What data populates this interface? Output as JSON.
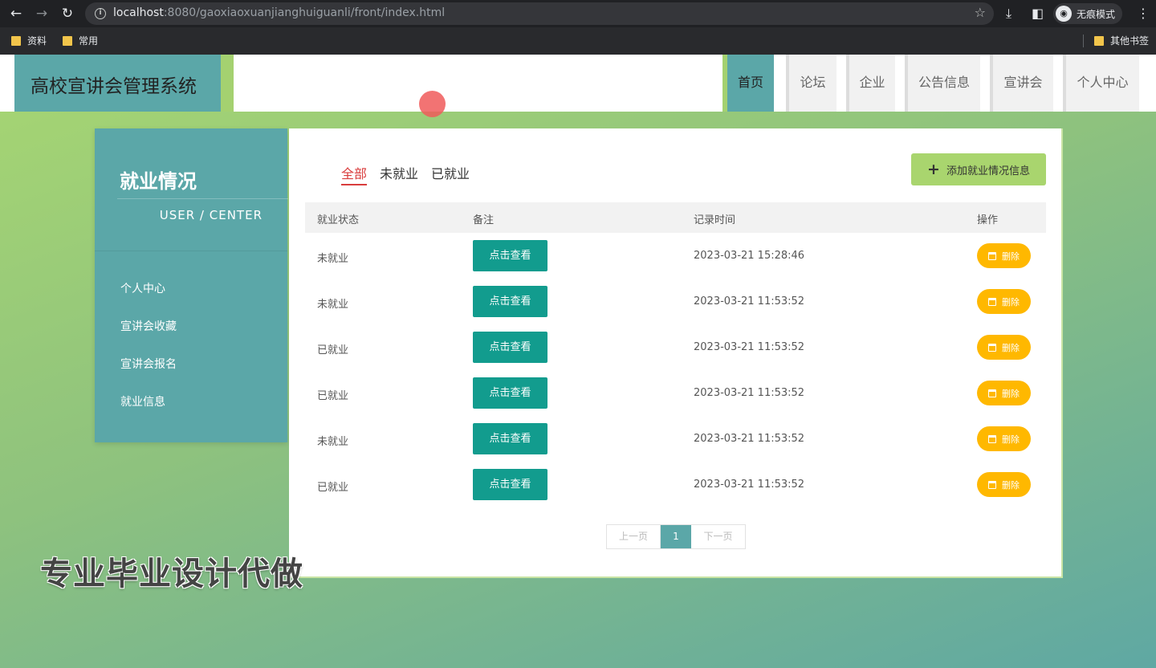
{
  "browser": {
    "back_icon": "arrow-left-icon",
    "url_host": "localhost",
    "url_path": ":8080/gaoxiaoxuanjianghuiguanli/front/index.html",
    "incognito_label": "无痕模式",
    "bookmarks": [
      "资料",
      "常用"
    ],
    "other_bookmarks": "其他书签"
  },
  "header": {
    "site_title": "高校宣讲会管理系统",
    "menu": [
      "首页",
      "论坛",
      "企业",
      "公告信息",
      "宣讲会",
      "个人中心"
    ],
    "active_menu": "首页"
  },
  "sidebar": {
    "title": "就业情况",
    "subtitle": "USER / CENTER",
    "items": [
      "个人中心",
      "宣讲会收藏",
      "宣讲会报名",
      "就业信息"
    ]
  },
  "content": {
    "filters": [
      "全部",
      "未就业",
      "已就业"
    ],
    "active_filter": "全部",
    "add_button": "添加就业情况信息",
    "columns": [
      "就业状态",
      "备注",
      "记录时间",
      "操作"
    ],
    "view_label": "点击查看",
    "delete_label": "删除",
    "rows": [
      {
        "status": "未就业",
        "time": "2023-03-21 15:28:46"
      },
      {
        "status": "未就业",
        "time": "2023-03-21 11:53:52"
      },
      {
        "status": "已就业",
        "time": "2023-03-21 11:53:52"
      },
      {
        "status": "已就业",
        "time": "2023-03-21 11:53:52"
      },
      {
        "status": "未就业",
        "time": "2023-03-21 11:53:52"
      },
      {
        "status": "已就业",
        "time": "2023-03-21 11:53:52"
      }
    ],
    "pagination": {
      "prev": "上一页",
      "current": "1",
      "next": "下一页"
    }
  },
  "watermark": "专业毕业设计代做",
  "colors": {
    "teal": "#5ba7a8",
    "green": "#a9d56e",
    "view_button": "#129c8e",
    "delete_button": "#ffb800",
    "active_filter": "#d93d3d"
  }
}
